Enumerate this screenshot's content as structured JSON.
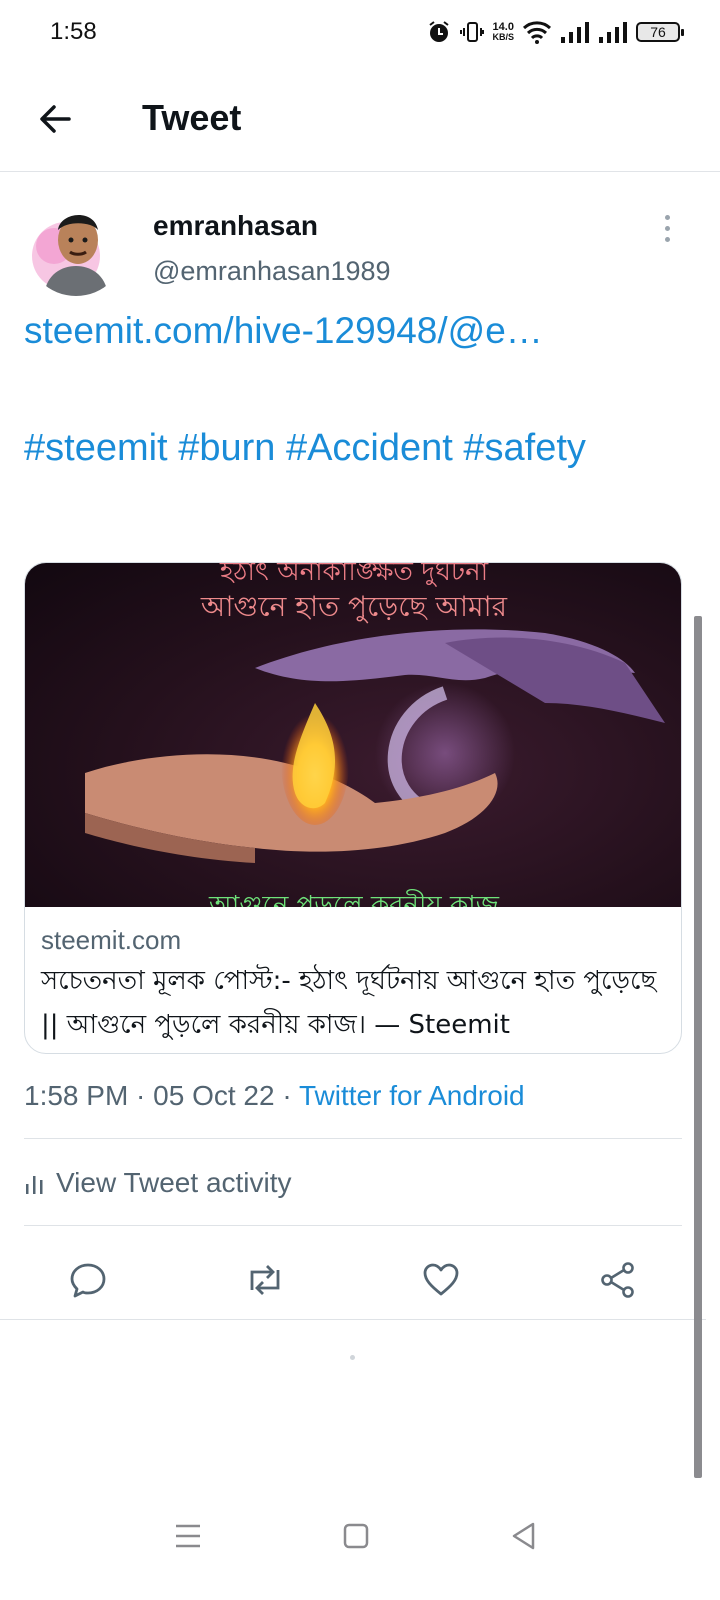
{
  "status_bar": {
    "time": "1:58",
    "speed_value": "14.0",
    "speed_unit": "KB/S",
    "battery": "76",
    "icons": [
      "alarm-icon",
      "vibrate-icon",
      "wifi-icon",
      "signal-icon",
      "signal-icon",
      "battery-icon"
    ]
  },
  "header": {
    "title": "Tweet",
    "back_icon": "arrow-left-icon"
  },
  "author": {
    "name": "emranhasan",
    "handle": "@emranhasan1989"
  },
  "tweet": {
    "link_text": "steemit.com/hive-129948/@e…",
    "hashtags": [
      "#steemit",
      "#burn",
      "#Accident",
      "#safety"
    ]
  },
  "card": {
    "image_text_top": "হঠাৎ অনাকাঙ্ক্ষিত দুর্ঘটনা",
    "image_text_title": "আগুনে হাত পুড়েছে আমার",
    "image_text_bottom": "আগুনে পুড়লে করনীয় কাজ",
    "domain": "steemit.com",
    "title": "সচেতনতা মূলক পোস্ট:- হঠাৎ দূর্ঘটনায় আগুনে হাত পুড়েছে || আগুনে পুড়লে করনীয় কাজ। — Steemit"
  },
  "meta": {
    "time": "1:58 PM",
    "separator": " · ",
    "date": "05 Oct 22",
    "source": "Twitter for Android"
  },
  "activity": {
    "label": "View Tweet activity",
    "icon": "bar-chart-icon"
  },
  "actions": [
    {
      "name": "reply",
      "icon": "comment-icon"
    },
    {
      "name": "retweet",
      "icon": "retweet-icon"
    },
    {
      "name": "like",
      "icon": "heart-icon"
    },
    {
      "name": "share",
      "icon": "share-icon"
    }
  ],
  "colors": {
    "accent": "#1a8cd8",
    "text_primary": "#0f1419",
    "text_secondary": "#536471"
  }
}
